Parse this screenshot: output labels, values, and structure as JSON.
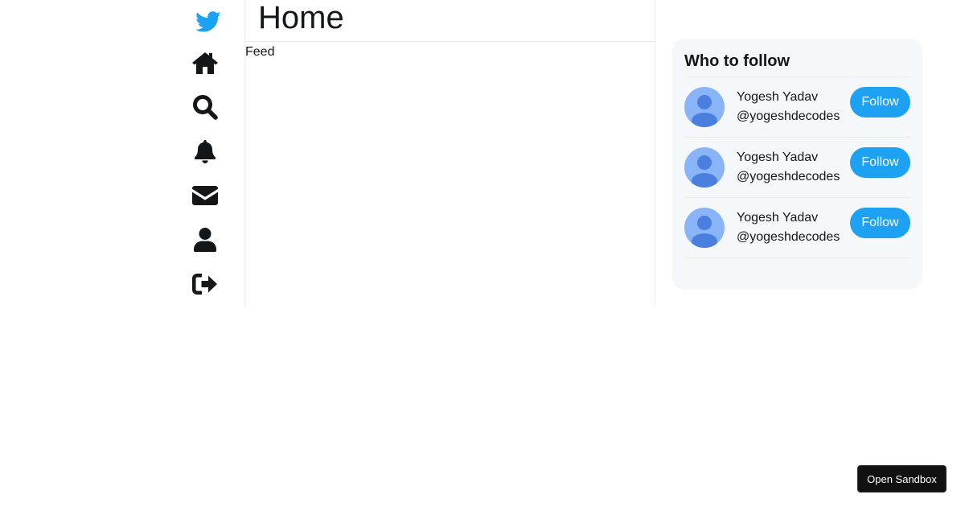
{
  "nav": {
    "items": [
      {
        "icon": "twitter-bird-icon",
        "color": "#1da1f2"
      },
      {
        "icon": "home-icon"
      },
      {
        "icon": "search-icon"
      },
      {
        "icon": "bell-icon"
      },
      {
        "icon": "envelope-icon"
      },
      {
        "icon": "user-icon"
      },
      {
        "icon": "sign-out-icon"
      }
    ]
  },
  "feed": {
    "title": "Home",
    "label": "Feed"
  },
  "widgets": {
    "title": "Who to follow",
    "suggestions": [
      {
        "name": "Yogesh Yadav",
        "handle": "@yogeshdecodes",
        "button": "Follow"
      },
      {
        "name": "Yogesh Yadav",
        "handle": "@yogeshdecodes",
        "button": "Follow"
      },
      {
        "name": "Yogesh Yadav",
        "handle": "@yogeshdecodes",
        "button": "Follow"
      }
    ]
  },
  "sandbox": {
    "label": "Open Sandbox"
  },
  "colors": {
    "accent": "#1da1f2",
    "icon": "#14171a",
    "widget_bg": "#f5f8fa",
    "avatar_bg": "#8ab4f8",
    "avatar_fg": "#4a7fe0"
  }
}
